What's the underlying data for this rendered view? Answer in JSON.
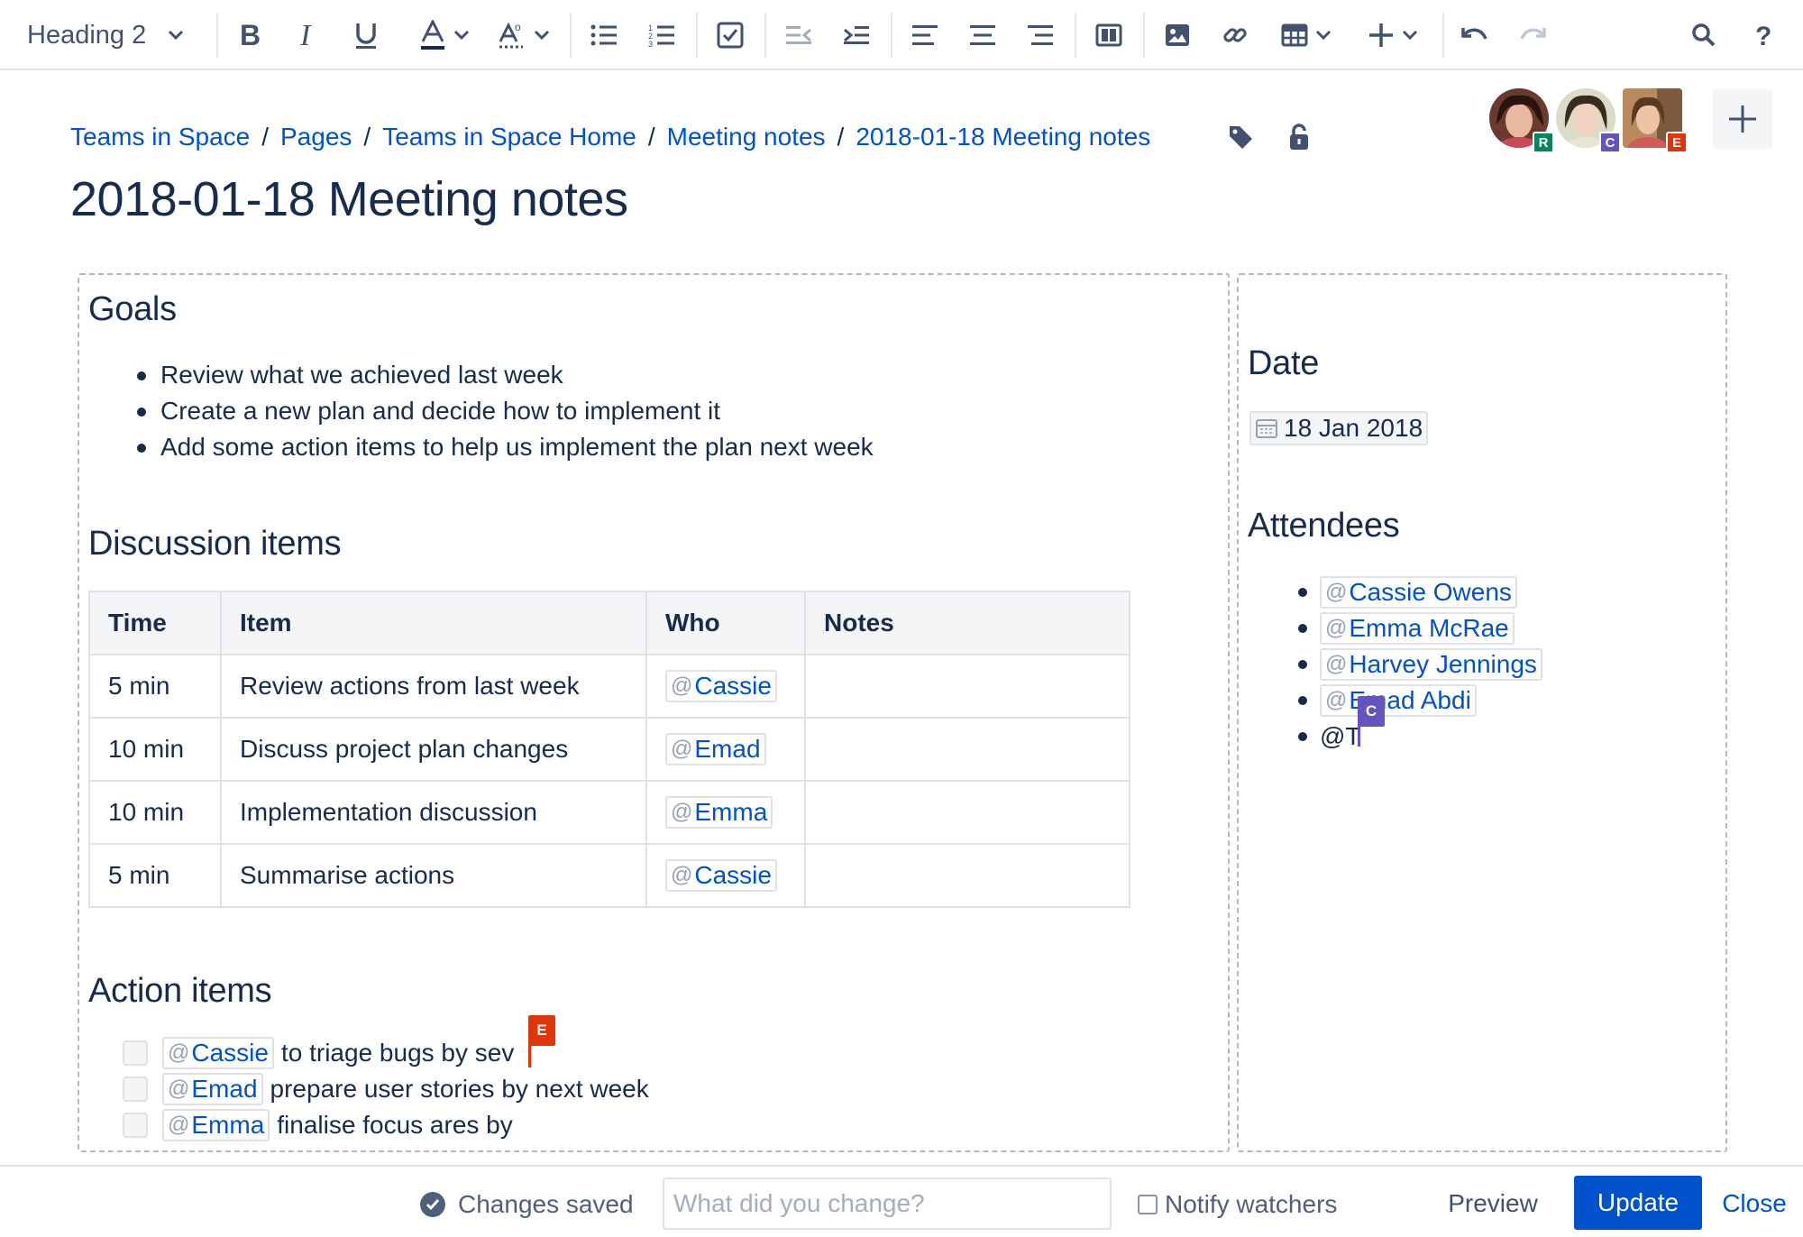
{
  "toolbar": {
    "text_style": "Heading 2",
    "icons": [
      "bold-icon",
      "italic-icon",
      "underline-icon",
      "text-color-icon",
      "clear-format-icon",
      "bullet-list-icon",
      "numbered-list-icon",
      "task-list-icon",
      "outdent-icon",
      "indent-icon",
      "align-left-icon",
      "align-center-icon",
      "align-right-icon",
      "page-layout-icon",
      "image-icon",
      "link-icon",
      "table-icon",
      "insert-plus-icon",
      "undo-icon",
      "redo-icon",
      "search-icon",
      "help-icon"
    ]
  },
  "breadcrumb": [
    "Teams in Space",
    "Pages",
    "Teams in Space Home",
    "Meeting notes",
    "2018-01-18 Meeting notes"
  ],
  "page_title": "2018-01-18 Meeting notes",
  "collaborators": [
    {
      "initial": "R",
      "color": "#00875A"
    },
    {
      "initial": "C",
      "color": "#6554C0"
    },
    {
      "initial": "E",
      "color": "#DE350B"
    }
  ],
  "goals": {
    "heading": "Goals",
    "items": [
      "Review what we achieved last week",
      "Create a new plan and decide how to implement it",
      "Add some action items to help us implement the plan next week"
    ]
  },
  "discussion": {
    "heading": "Discussion items",
    "columns": [
      "Time",
      "Item",
      "Who",
      "Notes"
    ],
    "rows": [
      {
        "time": "5 min",
        "item": "Review actions from last week",
        "who": "Cassie",
        "notes": ""
      },
      {
        "time": "10 min",
        "item": "Discuss project plan changes",
        "who": "Emad",
        "notes": ""
      },
      {
        "time": "10 min",
        "item": "Implementation discussion",
        "who": "Emma",
        "notes": ""
      },
      {
        "time": "5 min",
        "item": "Summarise actions",
        "who": "Cassie",
        "notes": ""
      }
    ]
  },
  "actions": {
    "heading": "Action items",
    "items": [
      {
        "who": "Cassie",
        "text": "to triage bugs by sev",
        "checked": false
      },
      {
        "who": "Emad",
        "text": "prepare user stories by next week",
        "checked": false
      },
      {
        "who": "Emma",
        "text": "finalise focus ares by",
        "checked": false
      }
    ]
  },
  "side": {
    "date_heading": "Date",
    "date": "18 Jan 2018",
    "attendees_heading": "Attendees",
    "attendees": [
      "Cassie Owens",
      "Emma McRae",
      "Harvey Jennings",
      "Emad Abdi"
    ],
    "typing": "@T"
  },
  "remote_cursors": [
    {
      "initial": "E",
      "color": "#DE350B"
    },
    {
      "initial": "C",
      "color": "#6554C0"
    }
  ],
  "footer": {
    "status": "Changes saved",
    "change_placeholder": "What did you change?",
    "notify_label": "Notify watchers",
    "preview_label": "Preview",
    "update_label": "Update",
    "close_label": "Close"
  },
  "mention_prefix": "@"
}
